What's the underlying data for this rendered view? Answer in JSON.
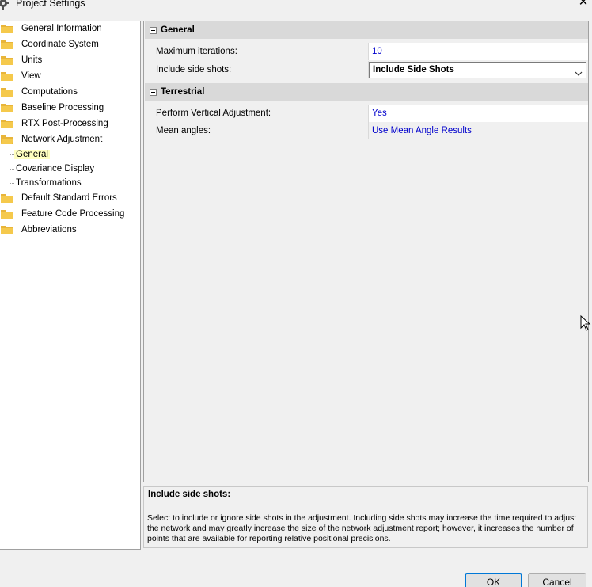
{
  "window": {
    "title": "Project Settings",
    "icon": "gear-icon",
    "close_glyph": "✕"
  },
  "tree": {
    "items": [
      {
        "label": "General Information"
      },
      {
        "label": "Coordinate System"
      },
      {
        "label": "Units"
      },
      {
        "label": "View"
      },
      {
        "label": "Computations"
      },
      {
        "label": "Baseline Processing"
      },
      {
        "label": "RTX Post-Processing"
      },
      {
        "label": "Network Adjustment"
      },
      {
        "label": "Default Standard Errors"
      },
      {
        "label": "Feature Code Processing"
      },
      {
        "label": "Abbreviations"
      }
    ],
    "children": [
      {
        "label": "General",
        "selected": true
      },
      {
        "label": "Covariance Display",
        "selected": false
      },
      {
        "label": "Transformations",
        "selected": false
      }
    ]
  },
  "grid": {
    "categories": [
      {
        "title": "General",
        "rows": [
          {
            "name": "Maximum iterations:",
            "value": "10"
          },
          {
            "name": "Include side shots:",
            "value": "Include Side Shots"
          }
        ]
      },
      {
        "title": "Terrestrial",
        "rows": [
          {
            "name": "Perform Vertical Adjustment:",
            "value": "Yes"
          },
          {
            "name": "Mean angles:",
            "value": "Use Mean Angle Results"
          }
        ]
      }
    ]
  },
  "help": {
    "title": "Include side shots:",
    "text": "Select to include or ignore side shots in the adjustment. Including side shots may increase the time required to adjust the network and may greatly increase the size of the network adjustment report; however, it increases the number of points that are available for reporting relative positional precisions."
  },
  "buttons": {
    "ok": "OK",
    "cancel": "Cancel"
  },
  "colors": {
    "folder": "#e8b53a",
    "accent": "#0078d7",
    "value_text": "#0000cc",
    "selected_bg": "#ffffc0"
  }
}
